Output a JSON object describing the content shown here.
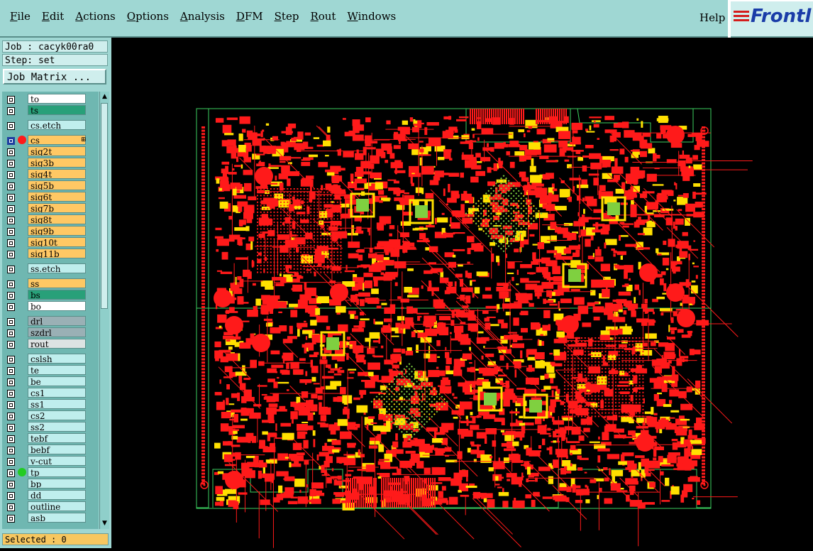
{
  "menubar": {
    "items": [
      {
        "label": "File",
        "ul": "F",
        "rest": "ile"
      },
      {
        "label": "Edit",
        "ul": "E",
        "rest": "dit"
      },
      {
        "label": "Actions",
        "ul": "A",
        "rest": "ctions"
      },
      {
        "label": "Options",
        "ul": "O",
        "rest": "ptions"
      },
      {
        "label": "Analysis",
        "ul": "A",
        "rest": "nalysis"
      },
      {
        "label": "DFM",
        "ul": "D",
        "rest": "FM"
      },
      {
        "label": "Step",
        "ul": "S",
        "rest": "tep"
      },
      {
        "label": "Rout",
        "ul": "R",
        "rest": "out"
      },
      {
        "label": "Windows",
        "ul": "W",
        "rest": "indows"
      }
    ],
    "help": "Help",
    "logo": "Frontl"
  },
  "panel": {
    "job": "Job : cacyk00ra0",
    "step": "Step: set",
    "job_matrix": "Job Matrix ...",
    "selected": "Selected : 0"
  },
  "colors": {
    "orange": "#ffc864",
    "teal": "#28a079",
    "white": "#ffffff",
    "cyan": "#bfeeed",
    "gray": "#9ab0b5",
    "lightgray": "#dde3e3",
    "copper_red": "#ff1a1a",
    "pad_yellow": "#ffe000",
    "outline_green": "#3cd060"
  },
  "layers": [
    {
      "name": "to",
      "color": "white"
    },
    {
      "name": "ts",
      "color": "teal"
    },
    {
      "name": "cs.etch",
      "color": "cyan"
    },
    {
      "name": "cs",
      "color": "orange",
      "active": true,
      "dot": "red",
      "extra": "⊞"
    },
    {
      "name": "sig2t",
      "color": "orange"
    },
    {
      "name": "sig3b",
      "color": "orange"
    },
    {
      "name": "sig4t",
      "color": "orange"
    },
    {
      "name": "sig5b",
      "color": "orange"
    },
    {
      "name": "sig6t",
      "color": "orange"
    },
    {
      "name": "sig7b",
      "color": "orange"
    },
    {
      "name": "sig8t",
      "color": "orange"
    },
    {
      "name": "sig9b",
      "color": "orange"
    },
    {
      "name": "sig10t",
      "color": "orange"
    },
    {
      "name": "sig11b",
      "color": "orange"
    },
    {
      "name": "ss.etch",
      "color": "cyan"
    },
    {
      "name": "ss",
      "color": "orange"
    },
    {
      "name": "bs",
      "color": "teal"
    },
    {
      "name": "bo",
      "color": "white"
    },
    {
      "name": "drl",
      "color": "gray"
    },
    {
      "name": "szdrl",
      "color": "gray"
    },
    {
      "name": "rout",
      "color": "lightgray"
    },
    {
      "name": "cslsh",
      "color": "cyan"
    },
    {
      "name": "te",
      "color": "cyan"
    },
    {
      "name": "be",
      "color": "cyan"
    },
    {
      "name": "cs1",
      "color": "cyan"
    },
    {
      "name": "ss1",
      "color": "cyan"
    },
    {
      "name": "cs2",
      "color": "cyan"
    },
    {
      "name": "ss2",
      "color": "cyan"
    },
    {
      "name": "tebf",
      "color": "cyan"
    },
    {
      "name": "bebf",
      "color": "cyan"
    },
    {
      "name": "v-cut",
      "color": "cyan"
    },
    {
      "name": "tp",
      "color": "cyan",
      "dot": "green"
    },
    {
      "name": "bp",
      "color": "cyan"
    },
    {
      "name": "dd",
      "color": "cyan"
    },
    {
      "name": "outline",
      "color": "cyan"
    },
    {
      "name": "asb",
      "color": "cyan"
    }
  ]
}
